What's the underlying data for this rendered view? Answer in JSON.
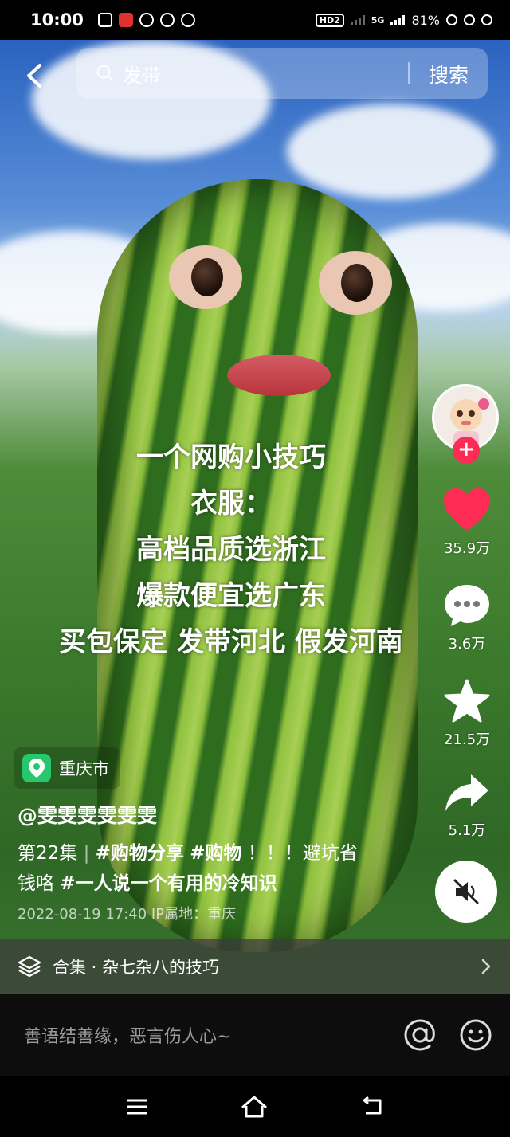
{
  "status_bar": {
    "time": "10:00",
    "battery": "81%",
    "network": "5G",
    "hd_label": "HD2"
  },
  "search": {
    "query": "发带",
    "button_label": "搜索"
  },
  "caption_lines": [
    "一个网购小技巧",
    "衣服：",
    "高档品质选浙江",
    "爆款便宜选广东",
    "买包保定 发带河北 假发河南"
  ],
  "rail": {
    "likes": "35.9万",
    "comments": "3.6万",
    "favorites": "21.5万",
    "shares": "5.1万",
    "follow_symbol": "+"
  },
  "location": "重庆市",
  "author": "@雯雯雯雯雯雯",
  "description": {
    "episode": "第22集",
    "separator": "|",
    "tag1": "#购物分享",
    "tag2": "#购物",
    "exclaim": "！！！避坑省钱咯",
    "tag3": "#一人说一个有用的冷知识"
  },
  "meta": "2022-08-19 17:40  IP属地：重庆",
  "collection": {
    "label": "合集 · 杂七杂八的技巧"
  },
  "comment": {
    "placeholder": "善语结善缘，恶言伤人心~"
  },
  "colors": {
    "like_red": "#fe2c55",
    "location_green": "#27c76b"
  }
}
